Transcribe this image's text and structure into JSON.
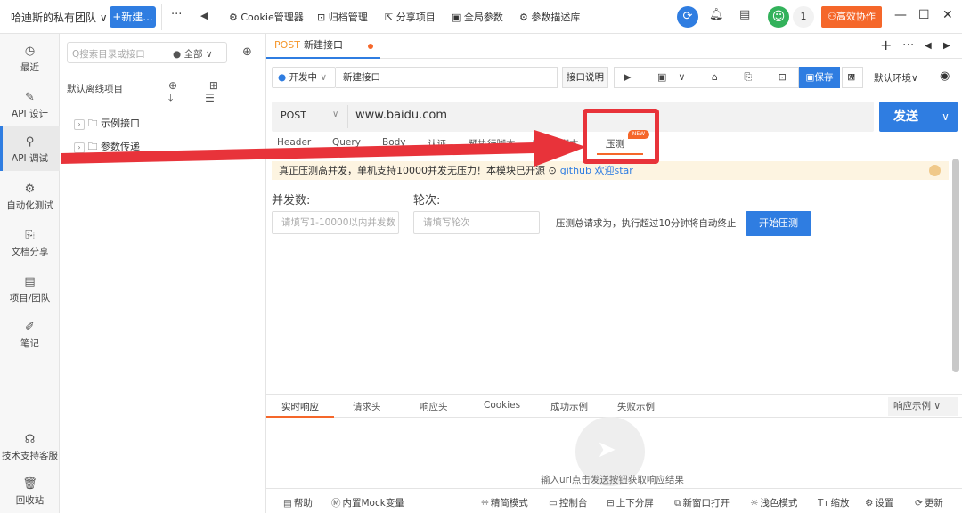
{
  "topbar": {
    "team_name": "哈迪斯的私有团队 ∨",
    "new_button": "+新建...",
    "more": "···",
    "back": "◀",
    "tools": [
      {
        "icon": "⚙",
        "label": "Cookie管理器"
      },
      {
        "icon": "⊡",
        "label": "归档管理"
      },
      {
        "icon": "⇱",
        "label": "分享项目"
      },
      {
        "icon": "▣",
        "label": "全局参数"
      },
      {
        "icon": "⚙",
        "label": "参数描述库"
      }
    ],
    "notification_count": "1",
    "collab_button": "高效协作",
    "window_controls": [
      "—",
      "☐",
      "✕"
    ]
  },
  "left_nav": {
    "items": [
      {
        "icon": "◷",
        "label": "最近"
      },
      {
        "icon": "✎",
        "label": "API 设计"
      },
      {
        "icon": "⚲",
        "label": "API 调试"
      },
      {
        "icon": "⚙",
        "label": "自动化测试"
      },
      {
        "icon": "⎘",
        "label": "文档分享"
      },
      {
        "icon": "▤",
        "label": "项目/团队"
      },
      {
        "icon": "✐",
        "label": "笔记"
      },
      {
        "icon": "☊",
        "label": "技术支持客服"
      },
      {
        "icon": "🗑",
        "label": "回收站"
      }
    ],
    "active_index": 2
  },
  "tree": {
    "search_placeholder": "Q搜索目录或接口",
    "filter": "● 全部  ∨",
    "target_icon": "⊕",
    "project_title": "默认离线项目",
    "actions": "⊕ ⊞ ⤓ ☰",
    "folders": [
      {
        "label": "示例接口"
      },
      {
        "label": "参数传递"
      }
    ]
  },
  "tabs": {
    "active": {
      "method": "POST",
      "name": "新建接口"
    },
    "right_icons": [
      "+",
      "···",
      "◀",
      "▶"
    ]
  },
  "request": {
    "env": "开发中",
    "api_name": "新建接口",
    "doc_button": "接口说明",
    "toolbar_icons": "▶ ▣∨ ⌂ ⎘ ⊡ ⇱ ⊠",
    "save_label": "保存",
    "default_env": "默认环境∨",
    "method": "POST",
    "url": "www.baidu.com",
    "send_label": "发送"
  },
  "request_tabs": [
    {
      "label": "Header"
    },
    {
      "label": "Query"
    },
    {
      "label": "Body"
    },
    {
      "label": "认证"
    },
    {
      "label": "预执行脚本"
    },
    {
      "label": "后执行脚本"
    },
    {
      "label": "压测"
    }
  ],
  "new_badge": "NEW",
  "banner": {
    "text": "真正压测高并发，单机支持10000并发无压力！本模块已开源",
    "github_icon": "⊙",
    "link": "github 欢迎star"
  },
  "stress": {
    "concurrency_label": "并发数:",
    "concurrency_placeholder": "请填写1-10000以内并发数",
    "rounds_label": "轮次:",
    "rounds_placeholder": "请填写轮次",
    "hint": "压测总请求为，执行超过10分钟将自动终止",
    "start_button": "开始压测"
  },
  "response": {
    "tabs": [
      {
        "label": "实时响应"
      },
      {
        "label": "请求头"
      },
      {
        "label": "响应头"
      },
      {
        "label": "Cookies"
      },
      {
        "label": "成功示例"
      },
      {
        "label": "失败示例"
      }
    ],
    "example_select": "响应示例 ∨",
    "empty_hint": "输入url点击发送按钮获取响应结果"
  },
  "bottom_bar": [
    {
      "icon": "▤",
      "label": "帮助"
    },
    {
      "icon": "Ⓜ",
      "label": "内置Mock变量"
    },
    {
      "icon": "⁜",
      "label": "精简模式"
    },
    {
      "icon": "▭",
      "label": "控制台"
    },
    {
      "icon": "⊟",
      "label": "上下分屏"
    },
    {
      "icon": "⧉",
      "label": "新窗口打开"
    },
    {
      "icon": "☼",
      "label": "浅色模式"
    },
    {
      "icon": "Tт",
      "label": "缩放"
    },
    {
      "icon": "⚙",
      "label": "设置"
    },
    {
      "icon": "⟳",
      "label": "更新"
    }
  ],
  "colors": {
    "primary": "#2f7de1",
    "accent": "#f5672a",
    "annotation_red": "#e8333a"
  }
}
